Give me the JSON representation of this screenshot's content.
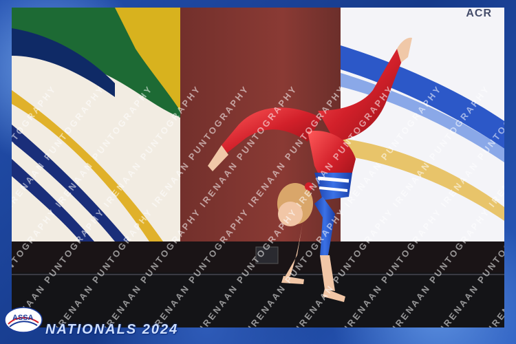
{
  "photo": {
    "corner_text": "ACR",
    "watermark_text": "IRENAAN PUNTOGRAPHY",
    "logo_text": "ASSA",
    "event_text": "NATIONALS 2024"
  },
  "colors": {
    "frame_blue": "#1f4aa8",
    "leotard_red": "#d2202a",
    "leotard_blue": "#2456c8",
    "curtain_dark": "#3a1e1c",
    "stage_floor": "#141417"
  }
}
